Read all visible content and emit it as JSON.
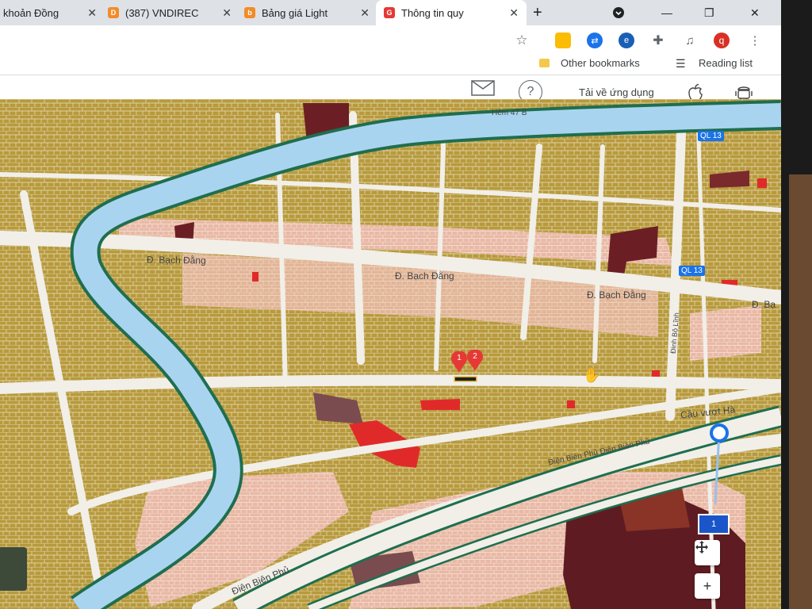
{
  "browser": {
    "tabs": [
      {
        "title": "khoản Đồng",
        "favicon_color": "#4285f4",
        "active": false
      },
      {
        "title": "(387) VNDIREC",
        "favicon_color": "#f28c28",
        "favicon_text": "D",
        "active": false
      },
      {
        "title": "Bảng giá Light",
        "favicon_color": "#f28c28",
        "favicon_text": "b",
        "active": false
      },
      {
        "title": "Thông tin quy",
        "favicon_color": "#e53935",
        "favicon_text": "G",
        "active": true
      }
    ],
    "new_tab_label": "+",
    "bookmarks": {
      "other_bookmarks": "Other bookmarks",
      "reading_list": "Reading list"
    },
    "profile_initial": "q"
  },
  "app_header": {
    "download_app_label": "Tải về ứng dụng",
    "help_label": "?"
  },
  "map": {
    "roads": {
      "bach_dang_1": "Đ. Bạch Đằng",
      "bach_dang_2": "Đ. Bạch Đằng",
      "bach_dang_3": "Đ. Bạ",
      "hem": "Hẻm 47 B",
      "dien_bien_phu_1": "Điện Biên Phủ",
      "dien_bien_phu_2": "Điện Biên Phủ Điện Biên Phủ",
      "cau_vuot": "Cầu vượt Hà",
      "dinh_bo_linh": "Đinh Bộ Lĩnh",
      "ql13_a": "QL 13",
      "ql13_b": "QL 13"
    },
    "markers": [
      "1",
      "2"
    ],
    "route_badge": "1",
    "controls": {
      "move_icon": "move-icon",
      "zoom_in_label": "+"
    },
    "colors": {
      "residential": "#b89a3c",
      "commercial": "#e9b9a5",
      "public": "#6b1f24",
      "river": "#a9d4ef",
      "road": "#f1efe8",
      "highlight_red": "#e02a2a"
    }
  }
}
